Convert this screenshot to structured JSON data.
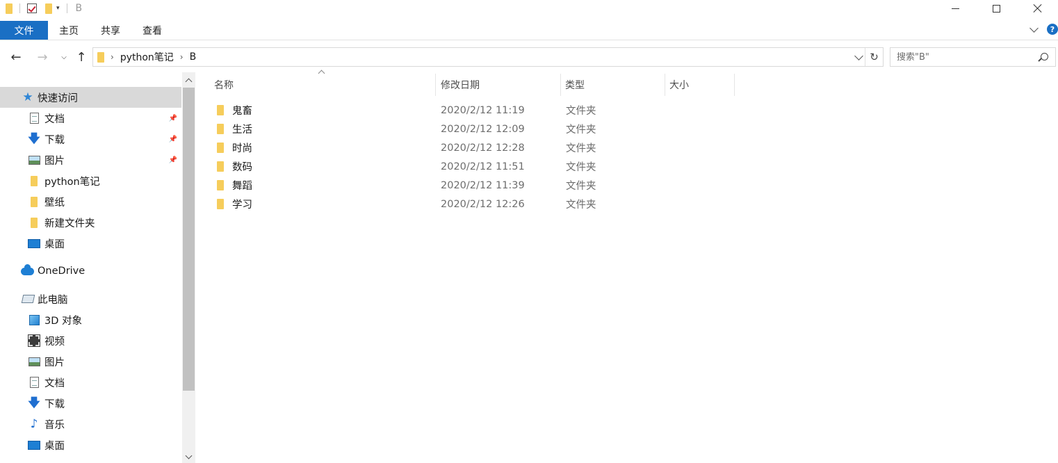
{
  "window": {
    "title": "B",
    "icons": [
      "folder-icon",
      "properties-icon",
      "new-folder-icon",
      "customize-dropdown-icon"
    ]
  },
  "ribbon": {
    "file_tab": "文件",
    "tabs": [
      "主页",
      "共享",
      "查看"
    ],
    "help": "?"
  },
  "nav": {
    "breadcrumb": [
      "python笔记",
      "B"
    ],
    "search_placeholder": "搜索\"B\""
  },
  "sidebar": {
    "items": [
      {
        "label": "快速访问",
        "icon": "star-icon",
        "active": true,
        "pinned": false
      },
      {
        "label": "文档",
        "icon": "document-icon",
        "pinned": true
      },
      {
        "label": "下载",
        "icon": "download-icon",
        "pinned": true
      },
      {
        "label": "图片",
        "icon": "picture-icon",
        "pinned": true
      },
      {
        "label": "python笔记",
        "icon": "folder-icon",
        "pinned": false
      },
      {
        "label": "壁纸",
        "icon": "folder-icon",
        "pinned": false
      },
      {
        "label": "新建文件夹",
        "icon": "folder-icon",
        "pinned": false
      },
      {
        "label": "桌面",
        "icon": "desktop-icon",
        "pinned": false
      },
      {
        "label": "OneDrive",
        "icon": "onedrive-icon"
      },
      {
        "label": "此电脑",
        "icon": "computer-icon"
      },
      {
        "label": "3D 对象",
        "icon": "3d-objects-icon"
      },
      {
        "label": "视频",
        "icon": "video-icon"
      },
      {
        "label": "图片",
        "icon": "picture-icon"
      },
      {
        "label": "文档",
        "icon": "document-icon"
      },
      {
        "label": "下载",
        "icon": "download-icon"
      },
      {
        "label": "音乐",
        "icon": "music-icon"
      },
      {
        "label": "桌面",
        "icon": "desktop-icon"
      }
    ]
  },
  "table": {
    "columns": [
      "名称",
      "修改日期",
      "类型",
      "大小"
    ],
    "rows": [
      {
        "name": "鬼畜",
        "date": "2020/2/12 11:19",
        "type": "文件夹"
      },
      {
        "name": "生活",
        "date": "2020/2/12 12:09",
        "type": "文件夹"
      },
      {
        "name": "时尚",
        "date": "2020/2/12 12:28",
        "type": "文件夹"
      },
      {
        "name": "数码",
        "date": "2020/2/12 11:51",
        "type": "文件夹"
      },
      {
        "name": "舞蹈",
        "date": "2020/2/12 11:39",
        "type": "文件夹"
      },
      {
        "name": "学习",
        "date": "2020/2/12 12:26",
        "type": "文件夹"
      }
    ]
  }
}
